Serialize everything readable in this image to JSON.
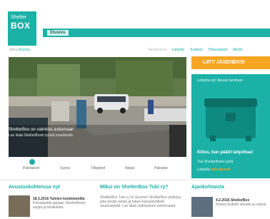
{
  "logo": {
    "line1": "Shelter",
    "line2": "BOX"
  },
  "topbar": {
    "home": "Etusivu"
  },
  "nav": {
    "breadcrumb_prefix": "Siirry",
    "breadcrumb_link": "Etusivu",
    "right_links": [
      "Tapahtumat",
      "Lahjoita",
      "Tuotteet",
      "Yhteystiedot",
      "Media"
    ]
  },
  "hero": {
    "caption": "ShelterBox on valmiina auttamaan",
    "subcaption": "Lue lisää ShelterBoxin työstä maailmalla"
  },
  "tabs": [
    "Pakolaiset",
    "Syyria",
    "Filippiinit",
    "Nepal",
    "Pakistan"
  ],
  "join": {
    "label": "LIITY JÄSENEKSI"
  },
  "promo": {
    "head": "Lahjoita nyt! Apuasi tarvitaan",
    "title": "Kiitos, kun päätit lahjoittaa!",
    "line1": "Tue ShelterBoxin työtä",
    "line2_prefix": "Lahjoita",
    "line2_link": "lahjoita nyt!"
  },
  "sections": [
    {
      "title": "Avustuskohteissa nyt",
      "date": "18.3.2016 Tulvien koettelemilla",
      "teaser": "Kriisialueilla jaetaan ShelterBoxin suojia ja tarvikkeita."
    },
    {
      "title": "Miksi on ShelterBox Tuki ry?",
      "teaser": "ShelterBox Tuki ry on Suomen ShelterBox-yhdistys, joka kerää varoja ja tukee kansainvälistä avustustyötä. Lue lisää yhdistyksen toiminnasta."
    },
    {
      "title": "Ajankohtaista",
      "date": "4.2.2016 ShelterBox",
      "teaser": "Rotary-klubien vierailu ja uutisia"
    }
  ],
  "colors": {
    "accent": "#1bb1a6",
    "join": "#f5a623"
  }
}
